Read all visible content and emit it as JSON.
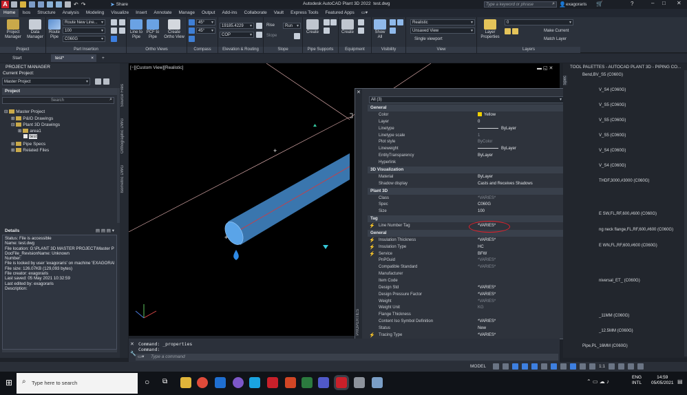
{
  "window": {
    "title": "Autodesk AutoCAD Plant 3D 2022",
    "file": "test.dwg",
    "share_label": "Share",
    "search_placeholder": "Type a keyword or phrase",
    "user": "exagoraris",
    "help": "?"
  },
  "ribbon_tabs": [
    "Home",
    "Isos",
    "Structure",
    "Analysis",
    "Modeling",
    "Visualize",
    "Insert",
    "Annotate",
    "Manage",
    "Output",
    "Add-ins",
    "Collaborate",
    "Vault",
    "Express Tools",
    "Featured Apps"
  ],
  "ribbon": {
    "project_btn": "Project Manager",
    "data_btn": "Data Manager",
    "project_panel": "Project",
    "route_pipe_btn": "Route Pipe",
    "route_dd": "Route New Line...",
    "size_dd": "100",
    "spec_dd": "C060G",
    "part_panel": "Part Insertion",
    "line_to_pipe": "Line to Pipe",
    "pcf_to_pipe": "PCF to Pipe",
    "create_ortho": "Create Ortho View",
    "ortho_panel": "Ortho Views",
    "angle1": "45°",
    "angle2": "45°",
    "compass_panel": "Compass",
    "elevation_value": "19185.4229",
    "cop_dd": "COP",
    "elev_panel": "Elevation & Routing",
    "rise": "Rise",
    "run": "Run",
    "slope": "Slope",
    "slope_panel": "Slope",
    "create1": "Create",
    "pipe_supports_panel": "Pipe Supports",
    "create2": "Create",
    "equipment_panel": "Equipment",
    "show_all": "Show All",
    "visibility_panel": "Visibility",
    "visual_style": "Realistic",
    "saved_view": "Unsaved View",
    "viewport_cfg": "Single viewport",
    "view_panel": "View",
    "layer_props": "Layer Properties",
    "layer_value": "0",
    "make_current": "Make Current",
    "match_layer": "Match Layer",
    "layers_panel": "Layers"
  },
  "doc_tabs": {
    "start": "Start",
    "test": "test*"
  },
  "project_manager": {
    "title": "PROJECT MANAGER",
    "current_label": "Current Project:",
    "current_value": "Master Project",
    "project_label": "Project",
    "search_placeholder": "Search",
    "tree": [
      "Master Project",
      "P&ID Drawings",
      "Plant 3D Drawings",
      "area1",
      "test",
      "Pipe Specs",
      "Related Files"
    ],
    "details_label": "Details",
    "details": [
      "Status: File is accessible",
      "Name: test.dwg",
      "File location: G:\\PLANT 3D MASTER PROJECT\\Master Proj",
      "DocFile_RevisionName:  Unknown",
      "Number:",
      "File is locked by user 'exagoraris' on machine 'EXAGORAR",
      "File size: 126.07KB (129,093 bytes)",
      "File creator: exagoraris",
      "Last saved: 05 May 2021 10:32:59",
      "Last edited by: exagoraris",
      "Description:"
    ],
    "vertical_tabs": [
      "Source Files",
      "Orthographic DWG",
      "Isometric DWG"
    ]
  },
  "viewport": {
    "label": "[−][Custom View][Realistic]"
  },
  "properties": {
    "selection": "All (3)",
    "side_label": "PROPERTIES",
    "color_yellow": "#f0d000",
    "highlight": "#e0202a",
    "sections": [
      {
        "cat": "General",
        "rows": [
          [
            "Color",
            "Yellow",
            ""
          ],
          [
            "Layer",
            "0",
            ""
          ],
          [
            "Linetype",
            "ByLayer",
            "line"
          ],
          [
            "Linetype scale",
            "1",
            "dim"
          ],
          [
            "Plot style",
            "ByColor",
            "dim"
          ],
          [
            "Lineweight",
            "ByLayer",
            "line"
          ],
          [
            "EntityTransparency",
            "ByLayer",
            ""
          ],
          [
            "Hyperlink",
            "",
            ""
          ]
        ]
      },
      {
        "cat": "3D Visualization",
        "rows": [
          [
            "Material",
            "ByLayer",
            ""
          ],
          [
            "Shadow display",
            "Casts and Receives Shadows",
            ""
          ]
        ]
      },
      {
        "cat": "Plant 3D",
        "rows": [
          [
            "Class",
            "*VARIES*",
            "dim"
          ],
          [
            "Spec",
            "C060G",
            ""
          ],
          [
            "Size",
            "100",
            ""
          ]
        ]
      },
      {
        "cat": "Tag",
        "rows": [
          [
            "Line Number Tag",
            "*VARIES*",
            "bolt"
          ]
        ]
      },
      {
        "cat": "General",
        "rows": [
          [
            "Insulation Thickness",
            "*VARIES*",
            "bolt"
          ],
          [
            "Insulation Type",
            "HC",
            "bolt"
          ],
          [
            "Service",
            "BFW",
            "bolt"
          ],
          [
            "PnPGuid",
            "*VARIES*",
            "dim"
          ],
          [
            "Compatible Standard",
            "*VARIES*",
            "dim"
          ],
          [
            "Manufacturer",
            "",
            ""
          ],
          [
            "Item Code",
            "",
            ""
          ],
          [
            "Design Std",
            "*VARIES*",
            ""
          ],
          [
            "Design Pressure Factor",
            "*VARIES*",
            ""
          ],
          [
            "Weight",
            "*VARIES*",
            "dim"
          ],
          [
            "Weight Unit",
            "KG",
            "dim"
          ],
          [
            "Flange Thickness",
            "",
            ""
          ],
          [
            "Content Iso Symbol Definition",
            "*VARIES*",
            ""
          ],
          [
            "Status",
            "New",
            ""
          ],
          [
            "Tracing Type",
            "*VARIES*",
            "bolt"
          ]
        ]
      }
    ]
  },
  "palette": {
    "title": "TOOL PALETTES - AUTOCAD PLANT 3D - PIPING CO...",
    "side_tab": "Spec",
    "items": [
      "Bend,BV_S5 (C060G)",
      "V_S4 (C060G)",
      "V_S5 (C060G)",
      "V_S5 (C060G)",
      "V_S5 (C060G)",
      "V_S4 (C060G)",
      "V_S4 (C060G)",
      "THDF,3000,#3000 (C060G)",
      "E SW,FL,RF,600,#600 (C060G)",
      "ng neck flange,FL,RF,600,#600 (C060G)",
      "E WN,FL,RF,600,#600 (C060G)",
      "niversal_ET_ (C060G)",
      "_11MM (C060G)",
      "_12.5MM (C060G)",
      "Pipe,PL_16MM (C060G)"
    ]
  },
  "command": {
    "line1": "Command:  _properties",
    "line2": "Command:",
    "placeholder": "Type a command"
  },
  "status": {
    "model": "MODEL",
    "scale": "1:1"
  },
  "taskbar": {
    "search_placeholder": "Type here to search",
    "lang1": "ENG",
    "lang2": "INTL",
    "time": "14:59",
    "date": "05/05/2021"
  }
}
